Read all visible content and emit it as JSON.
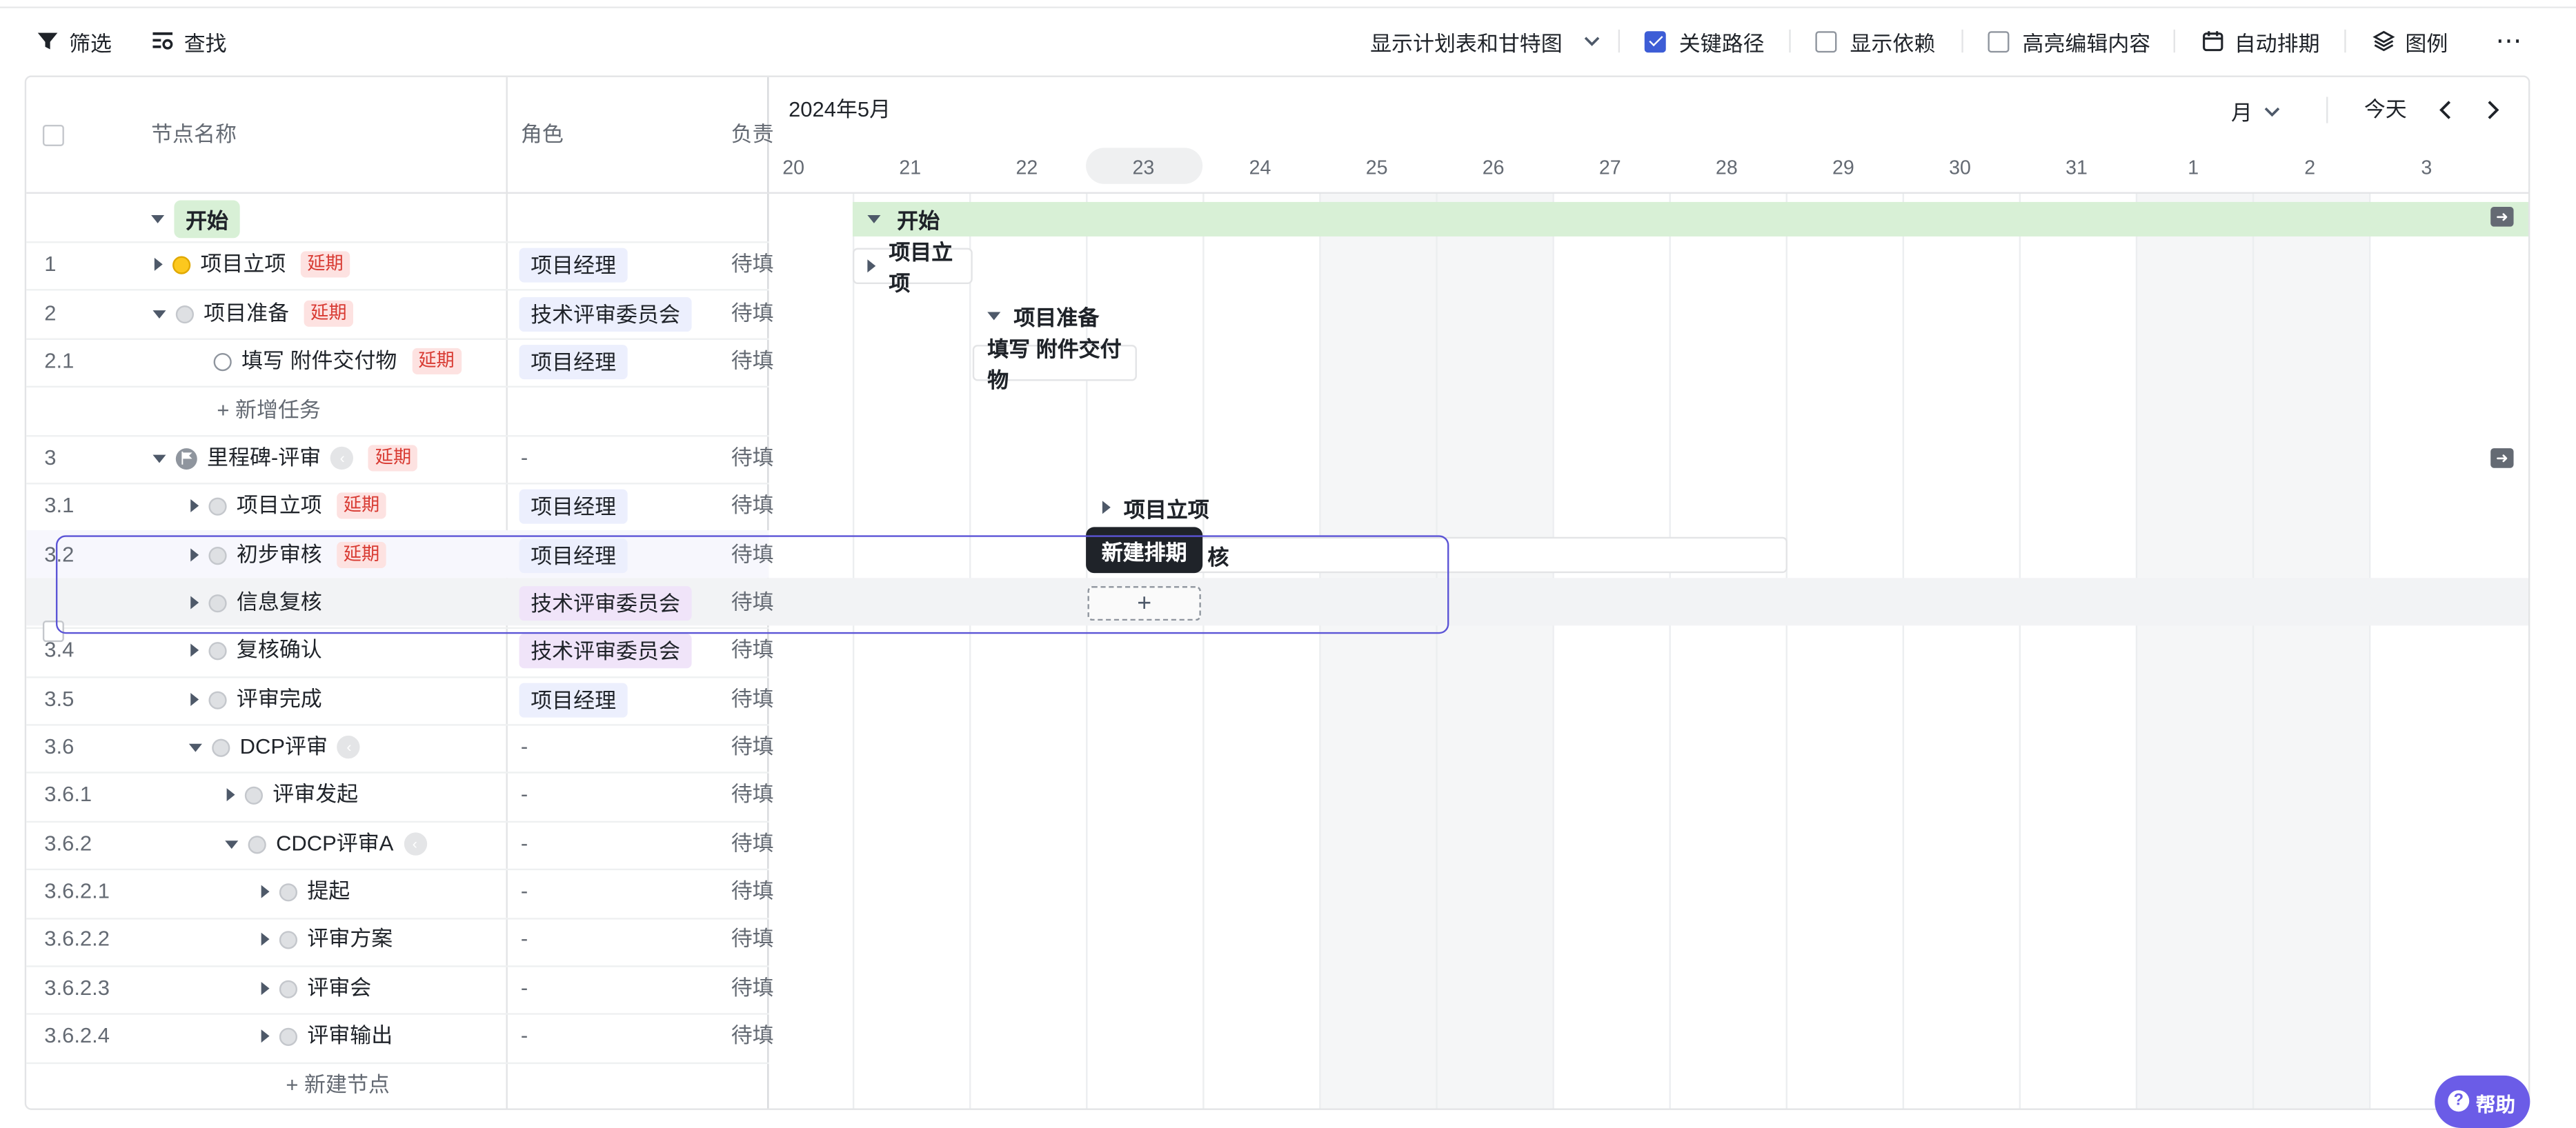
{
  "toolbar": {
    "filter": "筛选",
    "find": "查找",
    "view_mode": "显示计划表和甘特图",
    "critical_path": "关键路径",
    "show_deps": "显示依赖",
    "highlight_edit": "高亮编辑内容",
    "auto_schedule": "自动排期",
    "legend": "图例"
  },
  "table": {
    "columns": [
      "节点名称",
      "角色",
      "负责"
    ],
    "tag_delay": "延期",
    "rows": [
      {
        "num": "",
        "name": "开始",
        "role": "",
        "status": ""
      },
      {
        "num": "1",
        "name": "项目立项",
        "role": "项目经理",
        "status": "待填"
      },
      {
        "num": "2",
        "name": "项目准备",
        "role": "技术评审委员会",
        "status": "待填"
      },
      {
        "num": "2.1",
        "name": "填写 附件交付物",
        "role": "项目经理",
        "status": "待填"
      },
      {
        "num": "",
        "name": "+ 新增任务",
        "role": "",
        "status": ""
      },
      {
        "num": "3",
        "name": "里程碑-评审",
        "role": "-",
        "status": "待填"
      },
      {
        "num": "3.1",
        "name": "项目立项",
        "role": "项目经理",
        "status": "待填"
      },
      {
        "num": "3.2",
        "name": "初步审核",
        "role": "项目经理",
        "status": "待填"
      },
      {
        "num": "",
        "name": "信息复核",
        "role": "技术评审委员会",
        "status": "待填"
      },
      {
        "num": "3.4",
        "name": "复核确认",
        "role": "技术评审委员会",
        "status": "待填"
      },
      {
        "num": "3.5",
        "name": "评审完成",
        "role": "项目经理",
        "status": "待填"
      },
      {
        "num": "3.6",
        "name": "DCP评审",
        "role": "-",
        "status": "待填"
      },
      {
        "num": "3.6.1",
        "name": "评审发起",
        "role": "-",
        "status": "待填"
      },
      {
        "num": "3.6.2",
        "name": "CDCP评审A",
        "role": "-",
        "status": "待填"
      },
      {
        "num": "3.6.2.1",
        "name": "提起",
        "role": "-",
        "status": "待填"
      },
      {
        "num": "3.6.2.2",
        "name": "评审方案",
        "role": "-",
        "status": "待填"
      },
      {
        "num": "3.6.2.3",
        "name": "评审会",
        "role": "-",
        "status": "待填"
      },
      {
        "num": "3.6.2.4",
        "name": "评审输出",
        "role": "-",
        "status": "待填"
      }
    ],
    "add_node": "+ 新建节点"
  },
  "gantt": {
    "month_label": "2024年5月",
    "scale": "月",
    "today": "今天",
    "days": [
      "20",
      "21",
      "22",
      "23",
      "24",
      "25",
      "26",
      "27",
      "28",
      "29",
      "30",
      "31",
      "1",
      "2",
      "3"
    ],
    "bars": {
      "start": "开始",
      "proj_init": "项目立项",
      "proj_prep": "项目准备",
      "fill_attach": "填写 附件交付物",
      "proj_init_2": "项目立项",
      "review_partial": "核"
    },
    "tooltip": "新建排期",
    "plus": "+"
  },
  "help": "帮助",
  "colors": {
    "accent": "#5b54d6",
    "green_bar": "#d8f0d6",
    "delay_tag": "#d83931"
  }
}
